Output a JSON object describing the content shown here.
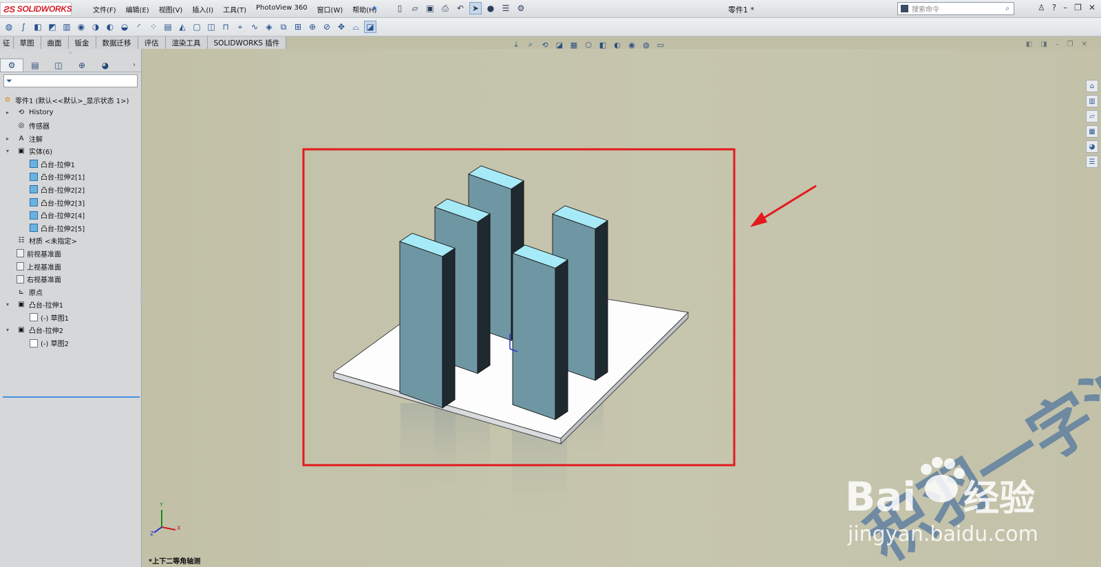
{
  "app": {
    "logo_text": "SOLIDWORKS",
    "logo_prefix": "ƧS"
  },
  "menu": [
    "文件(F)",
    "编辑(E)",
    "视图(V)",
    "插入(I)",
    "工具(T)",
    "PhotoView 360",
    "窗口(W)",
    "帮助(H)"
  ],
  "document_title": "零件1 *",
  "search": {
    "placeholder": "搜索命令"
  },
  "command_tabs": [
    "征",
    "草图",
    "曲面",
    "钣金",
    "数据迁移",
    "评估",
    "渲染工具",
    "SOLIDWORKS 插件"
  ],
  "feature_tree": {
    "root": "零件1 (默认<<默认>_显示状态 1>)",
    "items": [
      {
        "label": "History",
        "icon": "history-icon",
        "level": 1,
        "expander": "▸"
      },
      {
        "label": "传感器",
        "icon": "sensor-icon",
        "level": 1,
        "expander": ""
      },
      {
        "label": "注解",
        "icon": "annotation-icon",
        "level": 1,
        "expander": "▸"
      },
      {
        "label": "实体(6)",
        "icon": "solid-bodies-icon",
        "level": 1,
        "expander": "▾"
      },
      {
        "label": "凸台-拉伸1",
        "icon": "body-icon",
        "level": 2,
        "expander": ""
      },
      {
        "label": "凸台-拉伸2[1]",
        "icon": "body-icon",
        "level": 2,
        "expander": ""
      },
      {
        "label": "凸台-拉伸2[2]",
        "icon": "body-icon",
        "level": 2,
        "expander": ""
      },
      {
        "label": "凸台-拉伸2[3]",
        "icon": "body-icon",
        "level": 2,
        "expander": ""
      },
      {
        "label": "凸台-拉伸2[4]",
        "icon": "body-icon",
        "level": 2,
        "expander": ""
      },
      {
        "label": "凸台-拉伸2[5]",
        "icon": "body-icon",
        "level": 2,
        "expander": ""
      },
      {
        "label": "材质 <未指定>",
        "icon": "material-icon",
        "level": 1,
        "expander": ""
      },
      {
        "label": "前视基准面",
        "icon": "plane-icon",
        "level": 1,
        "expander": ""
      },
      {
        "label": "上视基准面",
        "icon": "plane-icon",
        "level": 1,
        "expander": ""
      },
      {
        "label": "右视基准面",
        "icon": "plane-icon",
        "level": 1,
        "expander": ""
      },
      {
        "label": "原点",
        "icon": "origin-icon",
        "level": 1,
        "expander": ""
      },
      {
        "label": "凸台-拉伸1",
        "icon": "extrude-icon",
        "level": 1,
        "expander": "▾"
      },
      {
        "label": "(-) 草图1",
        "icon": "sketch-icon",
        "level": 2,
        "expander": ""
      },
      {
        "label": "凸台-拉伸2",
        "icon": "extrude-icon",
        "level": 1,
        "expander": "▾"
      },
      {
        "label": "(-) 草图2",
        "icon": "sketch-icon",
        "level": 2,
        "expander": ""
      }
    ]
  },
  "view_name": "*上下二等角轴测",
  "triad_labels": {
    "x": "X",
    "y": "Y",
    "z": "Z"
  },
  "watermark": {
    "brand_left": "Bai",
    "brand_right": "经验",
    "url": "jingyan.baidu.com",
    "diagonal_text": "积羽一字波"
  },
  "colors": {
    "highlight_box": "#e3191b",
    "arrow": "#e3191b",
    "block_side": "#6f97a3",
    "block_top": "#a6eaf7",
    "block_dark": "#1f2a30",
    "plate": "#fdfdfd"
  }
}
